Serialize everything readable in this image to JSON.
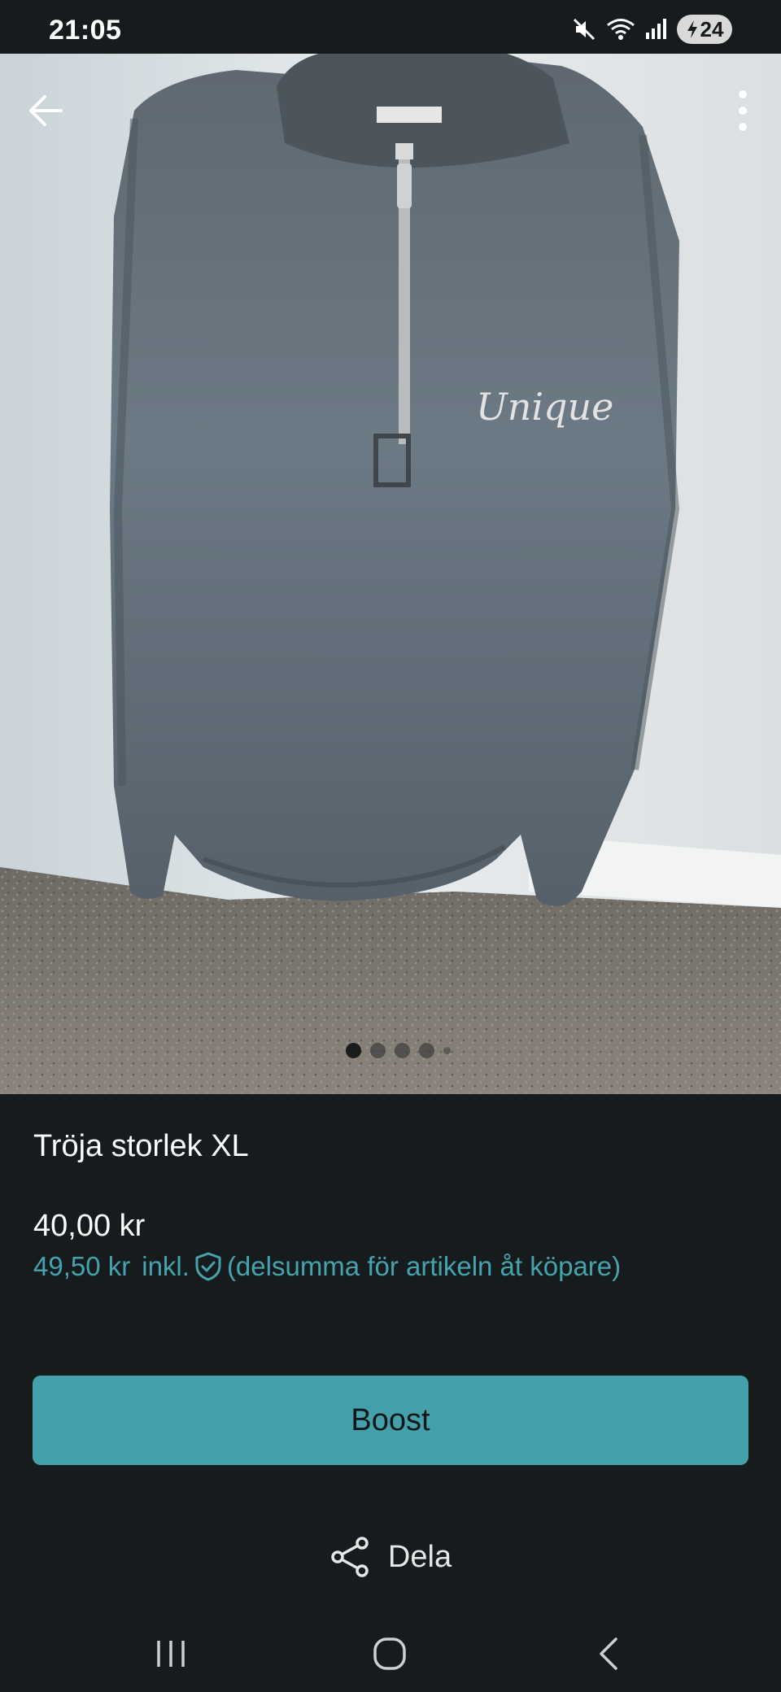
{
  "status_bar": {
    "time": "21:05",
    "battery_level": "24",
    "icons": [
      "mute-icon",
      "wifi-icon",
      "signal-icon",
      "battery-saver-icon"
    ]
  },
  "hero": {
    "image_description": "grey quarter-zip sweatshirt hanging on a white door",
    "carousel_pages": 5,
    "carousel_active_index": 0,
    "back_icon": "arrow-left-icon",
    "more_icon": "more-vertical-icon"
  },
  "item": {
    "title": "Tröja storlek XL",
    "price": "40,00 kr",
    "price_incl": "49,50 kr",
    "incl_label": "inkl.",
    "incl_note": "(delsumma för artikeln åt köpare)"
  },
  "actions": {
    "boost_label": "Boost",
    "share_label": "Dela"
  },
  "colors": {
    "background": "#161c1e",
    "accent": "#44a0aa",
    "accent_text": "#45a3ad"
  }
}
